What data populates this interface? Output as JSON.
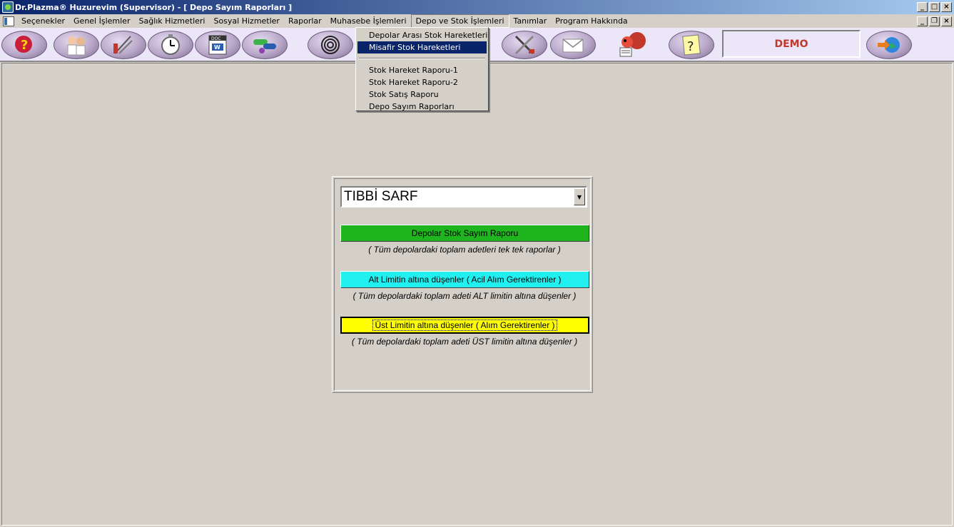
{
  "window": {
    "title": "Dr.Plazma® Huzurevim (Supervisor) - [ Depo Sayım Raporları ]",
    "controls": [
      "_",
      "□",
      "×"
    ]
  },
  "menubar": {
    "items": [
      "Seçenekler",
      "Genel İşlemler",
      "Sağlık Hizmetleri",
      "Sosyal Hizmetler",
      "Raporlar",
      "Muhasebe İşlemleri",
      "Depo ve Stok İşlemleri",
      "Tanımlar",
      "Program Hakkında"
    ],
    "mdi_controls": [
      "_",
      "❐",
      "×"
    ]
  },
  "dropdown": {
    "items": [
      "Depolar Arası Stok Hareketleri",
      "Misafir Stok Hareketleri",
      "Stok Hareket Raporu-1",
      "Stok Hareket Raporu-2",
      "Stok Satış Raporu",
      "Depo Sayım Raporları"
    ],
    "highlighted": "Misafir Stok Hareketleri"
  },
  "toolbar": {
    "icons": [
      "help-head-icon",
      "doctors-icon",
      "medical-tools-icon",
      "stopwatch-icon",
      "doc-word-icon",
      "pills-icon",
      "spiral-icon",
      "tools-icon",
      "mail-icon",
      "mascot-icon",
      "question-note-icon",
      "globe-exit-icon"
    ],
    "demo_label": "DEMO"
  },
  "panel": {
    "depot_select": "TIBBİ SARF",
    "buttons": {
      "stock_count": "Depolar Stok Sayım Raporu",
      "below_lower": "Alt Limitin altına düşenler ( Acil Alım Gerektirenler )",
      "below_upper": "Üst Limitin altına düşenler ( Alım Gerektirenler )"
    },
    "notes": {
      "stock_count": "( Tüm depolardaki toplam adetleri tek tek raporlar )",
      "below_lower": "( Tüm depolardaki toplam adeti ALT limitin altına düşenler )",
      "below_upper": "( Tüm depolardaki toplam adeti ÜST limitin altına düşenler )"
    }
  },
  "colors": {
    "titlebar": "#0a246a",
    "green_button": "#1fb51f",
    "cyan_button": "#22f0f0",
    "yellow_button": "#ffff00",
    "demo_text": "#c0392b"
  }
}
